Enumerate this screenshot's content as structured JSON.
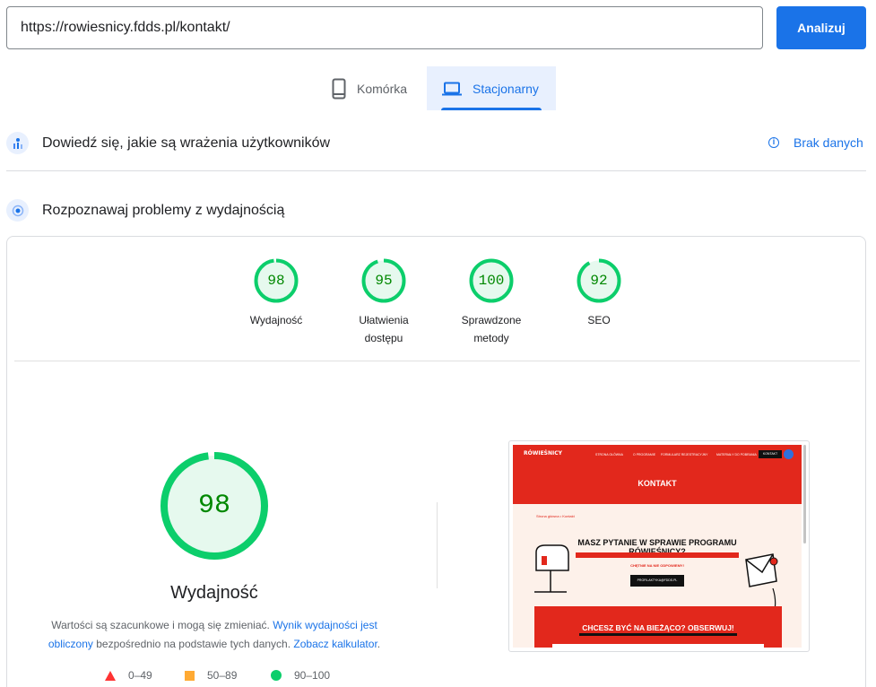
{
  "search": {
    "url_value": "https://rowiesnicy.fdds.pl/kontakt/",
    "analyze_label": "Analizuj"
  },
  "device_tabs": {
    "mobile_label": "Komórka",
    "desktop_label": "Stacjonarny",
    "selected": "desktop"
  },
  "field_data": {
    "title": "Dowiedź się, jakie są wrażenia użytkowników",
    "no_data_label": "Brak danych"
  },
  "lab_data": {
    "title": "Rozpoznawaj problemy z wydajnością"
  },
  "categories": [
    {
      "score": 98,
      "label_line1": "Wydajność",
      "label_line2": ""
    },
    {
      "score": 95,
      "label_line1": "Ułatwienia",
      "label_line2": "dostępu"
    },
    {
      "score": 100,
      "label_line1": "Sprawdzone",
      "label_line2": "metody"
    },
    {
      "score": 92,
      "label_line1": "SEO",
      "label_line2": ""
    }
  ],
  "performance": {
    "score": 98,
    "title": "Wydajność",
    "disclaimer_pre": "Wartości są szacunkowe i mogą się zmieniać. ",
    "disclaimer_link1": "Wynik wydajności jest obliczony",
    "disclaimer_mid": " bezpośrednio na podstawie tych danych. ",
    "disclaimer_link2": "Zobacz kalkulator",
    "disclaimer_end": "."
  },
  "legend": {
    "fail": "0–49",
    "average": "50–89",
    "pass": "90–100"
  },
  "thumbnail": {
    "logo": "RÓWIEŚNICY",
    "nav_items": [
      "STRONA GŁÓWNA",
      "O PROGRAMIE",
      "FORMULARZ REJESTRACYJNY",
      "MATERIAŁY DO POBRANIA"
    ],
    "nav_button": "KONTAKT",
    "hero_title": "KONTAKT",
    "breadcrumb": "Strona główna • Kontakt",
    "question": "MASZ PYTANIE W SPRAWIE PROGRAMU RÓWIEŚNICY?",
    "subtext": "CHĘTNIE NA NIE ODPOWIEMY!",
    "email_button": "PROFILAKTYKA@FDDS.PL",
    "follow_title": "CHCESZ BYĆ NA BIEŻĄCO? OBSERWUJ!"
  },
  "colors": {
    "accent": "#1a73e8",
    "pass": "#0cce6b",
    "pass_text": "#008800",
    "average": "#ffaa33",
    "fail": "#ff3333",
    "site_red": "#e2281c"
  }
}
